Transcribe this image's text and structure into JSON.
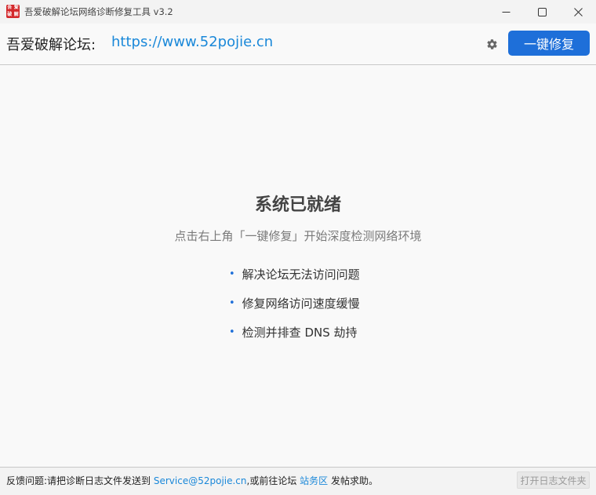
{
  "window": {
    "title": "吾爱破解论坛网络诊断修复工具 v3.2",
    "icon_chars": [
      "吾",
      "爱",
      "破",
      "解"
    ],
    "minimize_icon": "minimize-icon",
    "maximize_icon": "maximize-icon",
    "close_icon": "close-icon"
  },
  "header": {
    "site_label": "吾爱破解论坛:",
    "site_url": "https://www.52pojie.cn",
    "settings_icon": "gear-icon",
    "fix_button_label": "一键修复",
    "accent_color": "#1e6fd9",
    "link_color": "#1a88d9"
  },
  "main": {
    "status_title": "系统已就绪",
    "status_subtitle": "点击右上角「一键修复」开始深度检测网络环境",
    "features": [
      "解决论坛无法访问问题",
      "修复网络访问速度缓慢",
      "检测并排查 DNS 劫持"
    ]
  },
  "footer": {
    "prefix": "反馈问题:请把诊断日志文件发送到 ",
    "email": "Service@52pojie.cn",
    "middle": ",或前往论坛 ",
    "forum_link": "站务区",
    "suffix": " 发帖求助。",
    "open_log_button": "打开日志文件夹"
  }
}
